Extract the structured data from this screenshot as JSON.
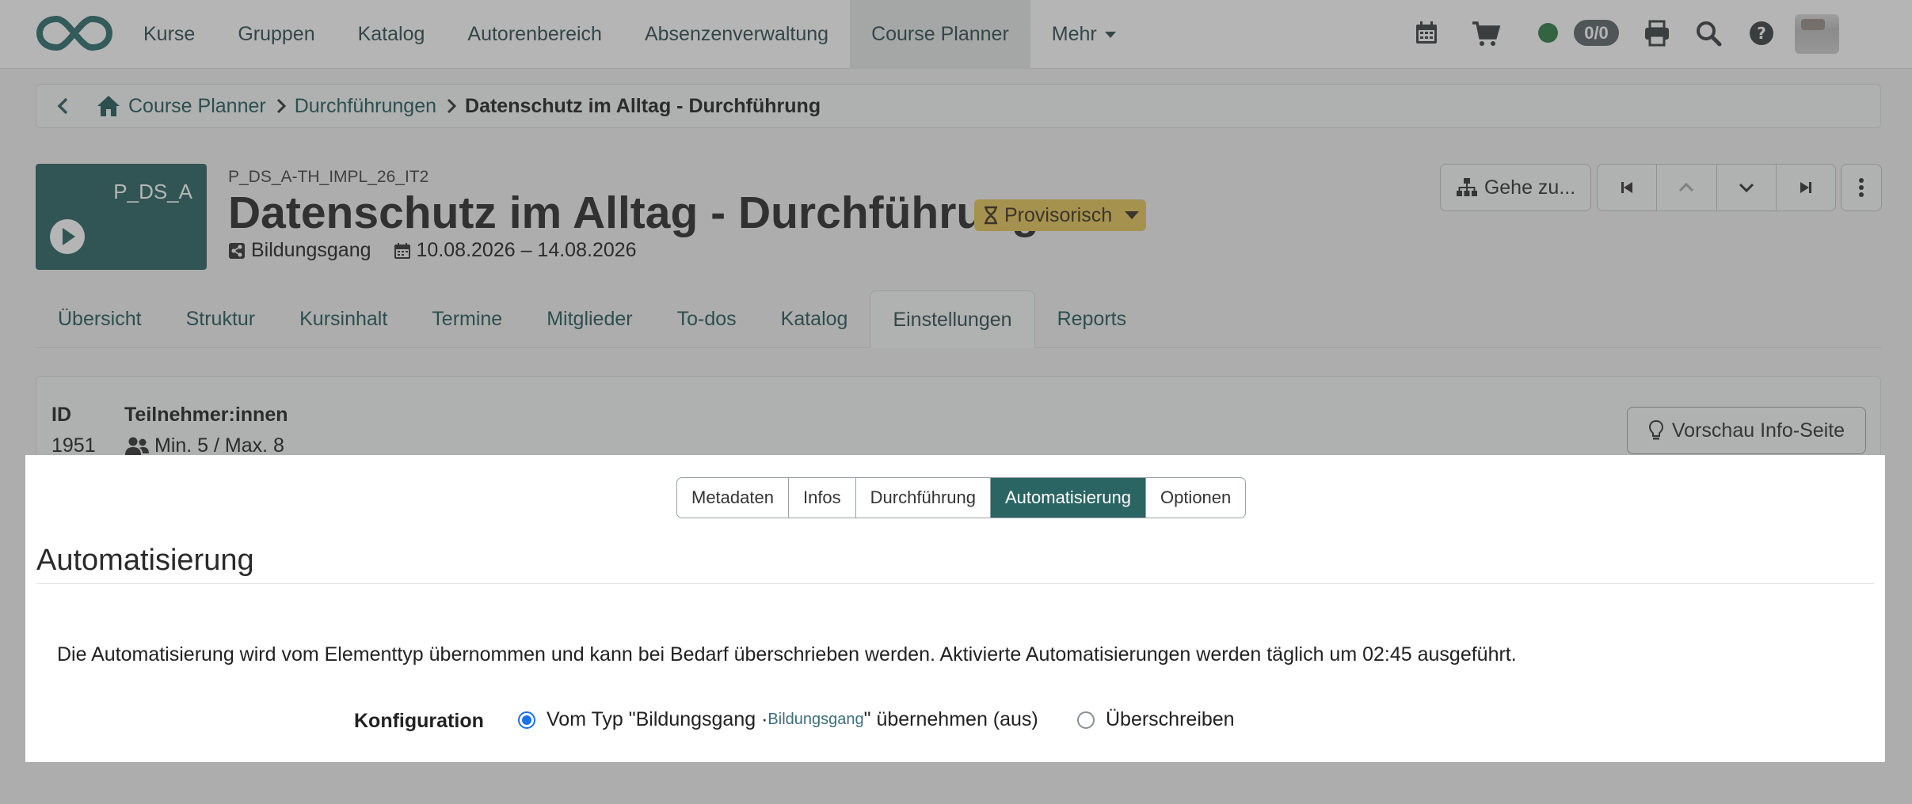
{
  "navbar": {
    "items": [
      {
        "label": "Kurse"
      },
      {
        "label": "Gruppen"
      },
      {
        "label": "Katalog"
      },
      {
        "label": "Autorenbereich"
      },
      {
        "label": "Absenzenverwaltung"
      },
      {
        "label": "Course Planner",
        "active": true
      },
      {
        "label": "Mehr"
      }
    ],
    "counter": "0/0"
  },
  "breadcrumb": {
    "items": [
      "Course Planner",
      "Durchführungen"
    ],
    "current": "Datenschutz im Alltag - Durchführung"
  },
  "header": {
    "thumbnail_label": "P_DS_A",
    "external_ref": "P_DS_A-TH_IMPL_26_IT2",
    "title": "Datenschutz im Alltag - Durchführung",
    "status": "Provisorisch",
    "type": "Bildungsgang",
    "dates": "10.08.2026 – 14.08.2026",
    "goto_label": "Gehe zu..."
  },
  "tabs": [
    "Übersicht",
    "Struktur",
    "Kursinhalt",
    "Termine",
    "Mitglieder",
    "To-dos",
    "Katalog",
    "Einstellungen",
    "Reports"
  ],
  "active_tab": "Einstellungen",
  "info": {
    "id_label": "ID",
    "id_value": "1951",
    "participants_label": "Teilnehmer:innen",
    "participants_value": "Min. 5 / Max. 8",
    "preview_label": "Vorschau Info-Seite"
  },
  "settings_tabs": [
    "Metadaten",
    "Infos",
    "Durchführung",
    "Automatisierung",
    "Optionen"
  ],
  "active_settings_tab": "Automatisierung",
  "section": {
    "title": "Automatisierung",
    "description": "Die Automatisierung wird vom Elementtyp übernommen und kann bei Bedarf überschrieben werden. Aktivierte Automatisierungen werden täglich um 02:45 ausgeführt.",
    "config_label": "Konfiguration",
    "option1_prefix": "Vom Typ \"Bildungsgang · ",
    "option1_link": "Bildungsgang",
    "option1_suffix": "\" übernehmen (aus)",
    "option2": "Überschreiben"
  },
  "colors": {
    "brand": "#2b6563",
    "status_badge": "#e7c75b",
    "radio_selected": "#1a73e8"
  }
}
